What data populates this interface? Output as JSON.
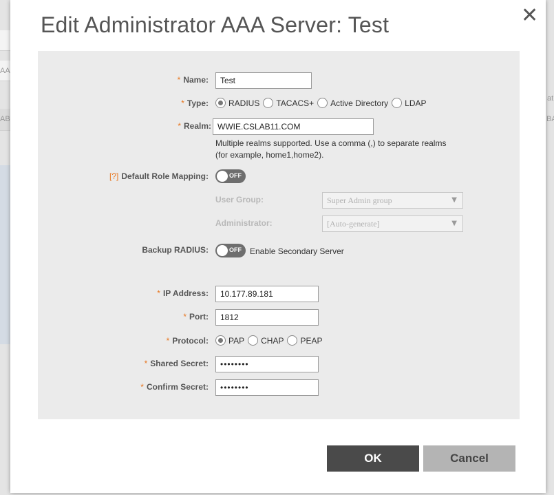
{
  "background": {
    "fragments": [
      "AA",
      "AB",
      "BA",
      "at"
    ]
  },
  "dialog": {
    "title": "Edit Administrator AAA Server: Test",
    "close_glyph": "✕"
  },
  "form": {
    "required_mark": "*",
    "help_mark": "[?]",
    "name": {
      "label": "Name:",
      "value": "Test"
    },
    "type": {
      "label": "Type:",
      "options": [
        "RADIUS",
        "TACACS+",
        "Active Directory",
        "LDAP"
      ],
      "selected": "RADIUS"
    },
    "realm": {
      "label": "Realm:",
      "value": "WWIE.CSLAB11.COM",
      "hint_line1": "Multiple realms supported. Use a comma (,) to separate realms",
      "hint_line2": "(for example, home1,home2)."
    },
    "default_role_mapping": {
      "label": "Default Role Mapping:",
      "toggle": "OFF"
    },
    "user_group": {
      "label": "User Group:",
      "value": "Super Admin group"
    },
    "administrator": {
      "label": "Administrator:",
      "value": "[Auto-generate]"
    },
    "backup_radius": {
      "label": "Backup RADIUS:",
      "toggle": "OFF",
      "text": "Enable Secondary Server"
    },
    "ip_address": {
      "label": "IP Address:",
      "value": "10.177.89.181"
    },
    "port": {
      "label": "Port:",
      "value": "1812"
    },
    "protocol": {
      "label": "Protocol:",
      "options": [
        "PAP",
        "CHAP",
        "PEAP"
      ],
      "selected": "PAP"
    },
    "shared_secret": {
      "label": "Shared Secret:",
      "value": "••••••••"
    },
    "confirm_secret": {
      "label": "Confirm Secret:",
      "value": "••••••••"
    }
  },
  "buttons": {
    "ok": "OK",
    "cancel": "Cancel"
  },
  "icons": {
    "close": "close-icon",
    "dropdown": "chevron-down-icon"
  }
}
